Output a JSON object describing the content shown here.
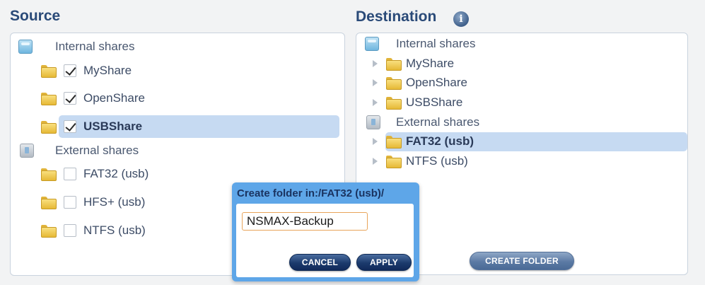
{
  "source": {
    "title": "Source",
    "internal_group": {
      "label": "Internal shares",
      "icon": "internal-drive-icon"
    },
    "internal_items": [
      {
        "label": "MyShare",
        "checked": true
      },
      {
        "label": "OpenShare",
        "checked": true
      },
      {
        "label": "USBShare",
        "checked": true,
        "selected": true
      }
    ],
    "external_group": {
      "label": "External shares",
      "icon": "external-drive-icon"
    },
    "external_items": [
      {
        "label": "FAT32 (usb)",
        "checked": false
      },
      {
        "label": "HFS+ (usb)",
        "checked": false
      },
      {
        "label": "NTFS (usb)",
        "checked": false
      }
    ]
  },
  "destination": {
    "title": "Destination",
    "info_icon": "i",
    "internal_group": {
      "label": "Internal shares"
    },
    "internal_items": [
      {
        "label": "MyShare"
      },
      {
        "label": "OpenShare"
      },
      {
        "label": "USBShare"
      }
    ],
    "external_group": {
      "label": "External shares"
    },
    "external_items": [
      {
        "label": "FAT32 (usb)",
        "selected": true
      },
      {
        "label": "NTFS (usb)"
      }
    ],
    "create_folder_label": "CREATE FOLDER"
  },
  "dialog": {
    "title": "Create folder in:/FAT32 (usb)/",
    "input_value": "NSMAX-Backup",
    "cancel_label": "CANCEL",
    "apply_label": "APPLY"
  },
  "colors": {
    "title": "#2a4a78",
    "selection": "#c6daf2",
    "dialog_frame": "#5ea6e8",
    "button_dark": "#1b3a6c"
  }
}
